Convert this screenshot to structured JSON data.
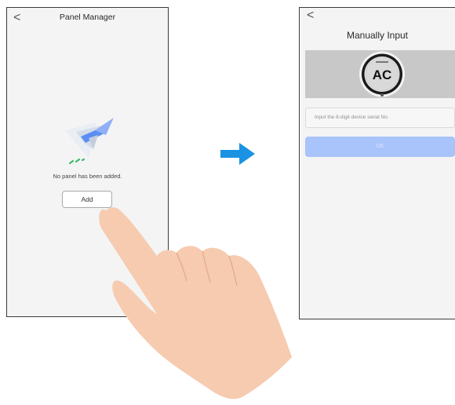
{
  "left_screen": {
    "back_icon": "chevron-left-icon",
    "back_glyph": "<",
    "title": "Panel Manager",
    "illustration": "paper-plane-icon",
    "empty_message": "No panel has been added.",
    "add_label": "Add"
  },
  "arrow": {
    "icon": "arrow-right-icon",
    "color": "#1a93e3"
  },
  "right_screen": {
    "back_icon": "chevron-left-icon",
    "back_glyph": "<",
    "title": "Manually Input",
    "device_image": "round-panel-device",
    "device_display": "AC",
    "serial_placeholder": "Input the 8-digit device serial No.",
    "ok_label": "OK"
  },
  "hand": {
    "icon": "pointing-hand-icon",
    "color": "#f6cbb0"
  },
  "colors": {
    "screen_bg": "#f4f4f4",
    "ok_button": "#a9c4fb",
    "banner": "#c8c8c8"
  }
}
